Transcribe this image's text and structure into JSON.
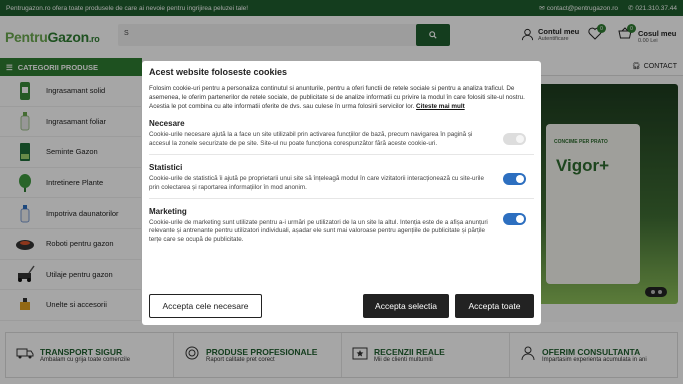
{
  "topbar": {
    "message": "Pentrugazon.ro ofera toate produsele de care ai nevoie pentru ingrijirea peluzei tale!",
    "email": "contact@pentrugazon.ro",
    "phone": "021.310.37.44"
  },
  "header": {
    "logo_part1": "Pentru",
    "logo_part2": "Gazon",
    "logo_part3": ".ro",
    "search_value": "S",
    "account_title": "Contul meu",
    "account_sub": "Autentificare",
    "wishlist_count": "0",
    "cart_count": "0",
    "cart_title": "Cosul meu",
    "cart_sub": "0.00 Lei"
  },
  "nav": {
    "categories_label": "CATEGORII PRODUSE",
    "contact_label": "CONTACT"
  },
  "sidebar": {
    "items": [
      {
        "label": "Ingrasamant solid",
        "icon": "fertilizer-bag-icon"
      },
      {
        "label": "Ingrasamant foliar",
        "icon": "spray-bottle-icon"
      },
      {
        "label": "Seminte Gazon",
        "icon": "seed-pack-icon"
      },
      {
        "label": "Intretinere Plante",
        "icon": "plant-icon"
      },
      {
        "label": "Impotriva daunatorilor",
        "icon": "pest-bottle-icon"
      },
      {
        "label": "Roboti pentru gazon",
        "icon": "robot-mower-icon"
      },
      {
        "label": "Utilaje pentru gazon",
        "icon": "lawn-mower-icon"
      },
      {
        "label": "Unelte si accesorii",
        "icon": "tool-icon"
      }
    ]
  },
  "hero": {
    "pack_subtitle": "CONCIME PER PRATO",
    "pack_title": "Vigor+"
  },
  "features": [
    {
      "title": "TRANSPORT SIGUR",
      "desc": "Ambalam cu grija toate comenzile",
      "icon": "truck-icon"
    },
    {
      "title": "PRODUSE PROFESIONALE",
      "desc": "Raport calitate pret corect",
      "icon": "medal-icon"
    },
    {
      "title": "RECENZII REALE",
      "desc": "Mii de clienti multumiti",
      "icon": "star-icon"
    },
    {
      "title": "OFERIM CONSULTANTA",
      "desc": "Impartasim experienta acumulata in ani",
      "icon": "person-icon"
    }
  ],
  "cookie": {
    "title": "Acest website foloseste cookies",
    "intro": "Folosim cookie-uri pentru a personaliza continutul si anunturile, pentru a oferi functii de retele sociale si pentru a analiza traficul. De asemenea, le oferim partenerilor de retele sociale, de publicitate si de analize informatii cu privire la modul în care folositi site-ul nostru. Acestia le pot combina cu alte informatii oferite de dvs. sau culese în urma folosirii servicilor lor.",
    "read_more": "Citeste mai mult",
    "sections": [
      {
        "title": "Necesare",
        "desc": "Cookie-urile necesare ajută la a face un site utilizabil prin activarea funcțiilor de bază, precum navigarea în pagină și accesul la zonele securizate de pe site. Site-ul nu poate funcționa corespunzător fără aceste cookie-uri.",
        "enabled": true,
        "locked": true
      },
      {
        "title": "Statistici",
        "desc": "Cookie-urile de statistică îi ajută pe proprietarii unui site să înțeleagă modul în care vizitatorii interacționează cu site-urile prin colectarea și raportarea informațiilor în mod anonim.",
        "enabled": true,
        "locked": false
      },
      {
        "title": "Marketing",
        "desc": "Cookie-urile de marketing sunt utilizate pentru a-i urmări pe utilizatori de la un site la altul. Intenția este de a afișa anunțuri relevante și antrenante pentru utilizatori individuali, așadar ele sunt mai valoroase pentru agențiile de publicitate și părțile terțe care se ocupă de publicitate.",
        "enabled": true,
        "locked": false
      }
    ],
    "btn_necessary": "Accepta cele necesare",
    "btn_selection": "Accepta selectia",
    "btn_all": "Accepta toate"
  }
}
